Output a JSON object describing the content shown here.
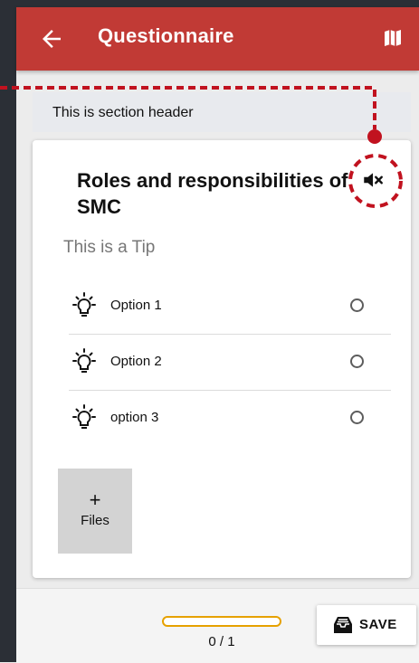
{
  "app_bar": {
    "title": "Questionnaire",
    "background": "#c13a35",
    "back_icon": "arrow-left-icon",
    "map_icon": "map-icon"
  },
  "section": {
    "header": "This is section header"
  },
  "question": {
    "title": "Roles and responsibilities of SMC",
    "tip": "This is a Tip",
    "audio_icon": "volume-mute-icon",
    "options": [
      {
        "label": "Option 1",
        "icon": "lightbulb-icon",
        "selected": false
      },
      {
        "label": "Option 2",
        "icon": "lightbulb-icon",
        "selected": false
      },
      {
        "label": "option 3",
        "icon": "lightbulb-icon",
        "selected": false
      }
    ]
  },
  "files_button": {
    "plus": "+",
    "label": "Files"
  },
  "footer": {
    "progress_text": "0 / 1",
    "progress_value": 0,
    "save_label": "SAVE",
    "save_icon": "inbox-tray-icon",
    "accent": "#e6a100"
  },
  "callout_color": "#c1121f"
}
